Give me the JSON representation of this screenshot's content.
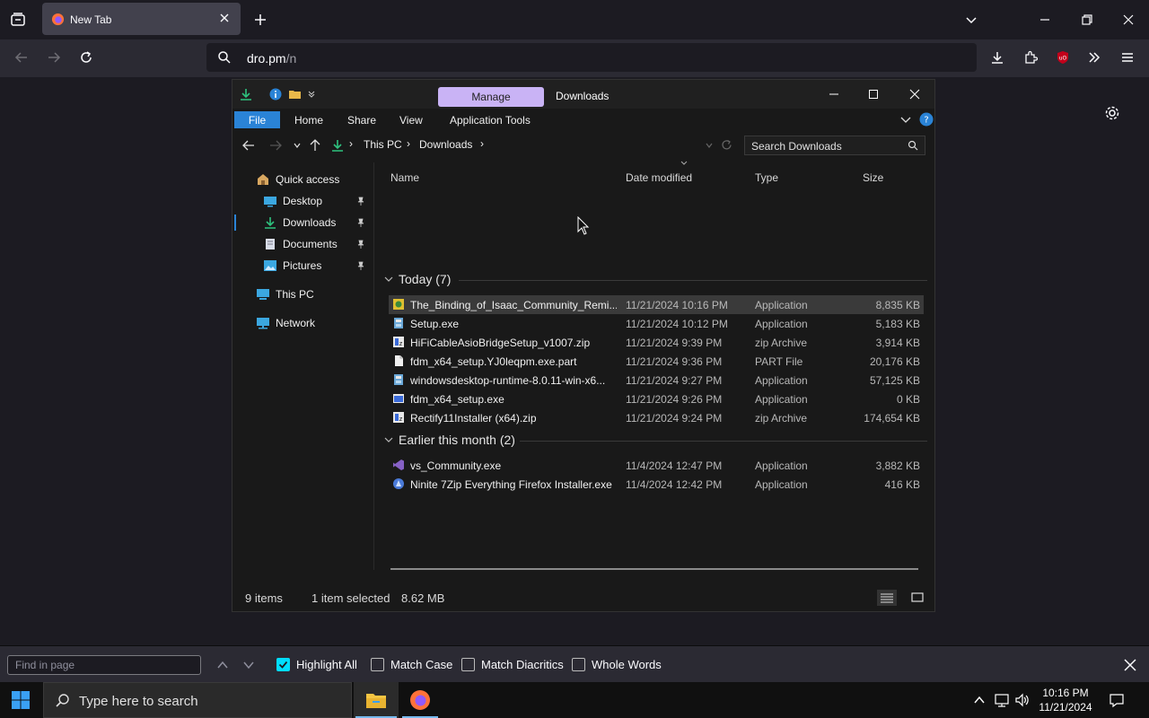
{
  "browser": {
    "tab_title": "New Tab",
    "url_main": "dro.pm",
    "url_rest": "/n"
  },
  "explorer": {
    "manage_label": "Manage",
    "window_title": "Downloads",
    "ribbon": {
      "file": "File",
      "home": "Home",
      "share": "Share",
      "view": "View",
      "app_tools": "Application Tools"
    },
    "breadcrumb": {
      "this_pc": "This PC",
      "downloads": "Downloads"
    },
    "search_placeholder": "Search Downloads",
    "nav": {
      "quick_access": "Quick access",
      "desktop": "Desktop",
      "downloads": "Downloads",
      "documents": "Documents",
      "pictures": "Pictures",
      "this_pc": "This PC",
      "network": "Network"
    },
    "columns": {
      "name": "Name",
      "date": "Date modified",
      "type": "Type",
      "size": "Size"
    },
    "groups": [
      {
        "label": "Today (7)",
        "files": [
          {
            "name": "The_Binding_of_Isaac_Community_Remi...",
            "date": "11/21/2024 10:16 PM",
            "type": "Application",
            "size": "8,835 KB",
            "icon": "game-icon",
            "selected": true
          },
          {
            "name": "Setup.exe",
            "date": "11/21/2024 10:12 PM",
            "type": "Application",
            "size": "5,183 KB",
            "icon": "installer-icon"
          },
          {
            "name": "HiFiCableAsioBridgeSetup_v1007.zip",
            "date": "11/21/2024 9:39 PM",
            "type": "zip Archive",
            "size": "3,914 KB",
            "icon": "zip-icon"
          },
          {
            "name": "fdm_x64_setup.YJ0leqpm.exe.part",
            "date": "11/21/2024 9:36 PM",
            "type": "PART File",
            "size": "20,176 KB",
            "icon": "file-icon"
          },
          {
            "name": "windowsdesktop-runtime-8.0.11-win-x6...",
            "date": "11/21/2024 9:27 PM",
            "type": "Application",
            "size": "57,125 KB",
            "icon": "installer-icon"
          },
          {
            "name": "fdm_x64_setup.exe",
            "date": "11/21/2024 9:26 PM",
            "type": "Application",
            "size": "0 KB",
            "icon": "exe-icon"
          },
          {
            "name": "Rectify11Installer (x64).zip",
            "date": "11/21/2024 9:24 PM",
            "type": "zip Archive",
            "size": "174,654 KB",
            "icon": "zip-icon"
          }
        ]
      },
      {
        "label": "Earlier this month (2)",
        "files": [
          {
            "name": "vs_Community.exe",
            "date": "11/4/2024 12:47 PM",
            "type": "Application",
            "size": "3,882 KB",
            "icon": "visual-studio-icon"
          },
          {
            "name": "Ninite 7Zip Everything Firefox Installer.exe",
            "date": "11/4/2024 12:42 PM",
            "type": "Application",
            "size": "416 KB",
            "icon": "ninite-icon"
          }
        ]
      }
    ],
    "status": {
      "items": "9 items",
      "selected": "1 item selected",
      "size": "8.62 MB"
    }
  },
  "findbar": {
    "placeholder": "Find in page",
    "highlight_all": "Highlight All",
    "match_case": "Match Case",
    "match_diacritics": "Match Diacritics",
    "whole_words": "Whole Words",
    "highlight_all_checked": true
  },
  "taskbar": {
    "search_placeholder": "Type here to search",
    "time": "10:16 PM",
    "date": "11/21/2024"
  },
  "colors": {
    "accent": "#00ddff",
    "manage_tab": "#c9b3f5",
    "file_tab": "#2a83d6"
  }
}
